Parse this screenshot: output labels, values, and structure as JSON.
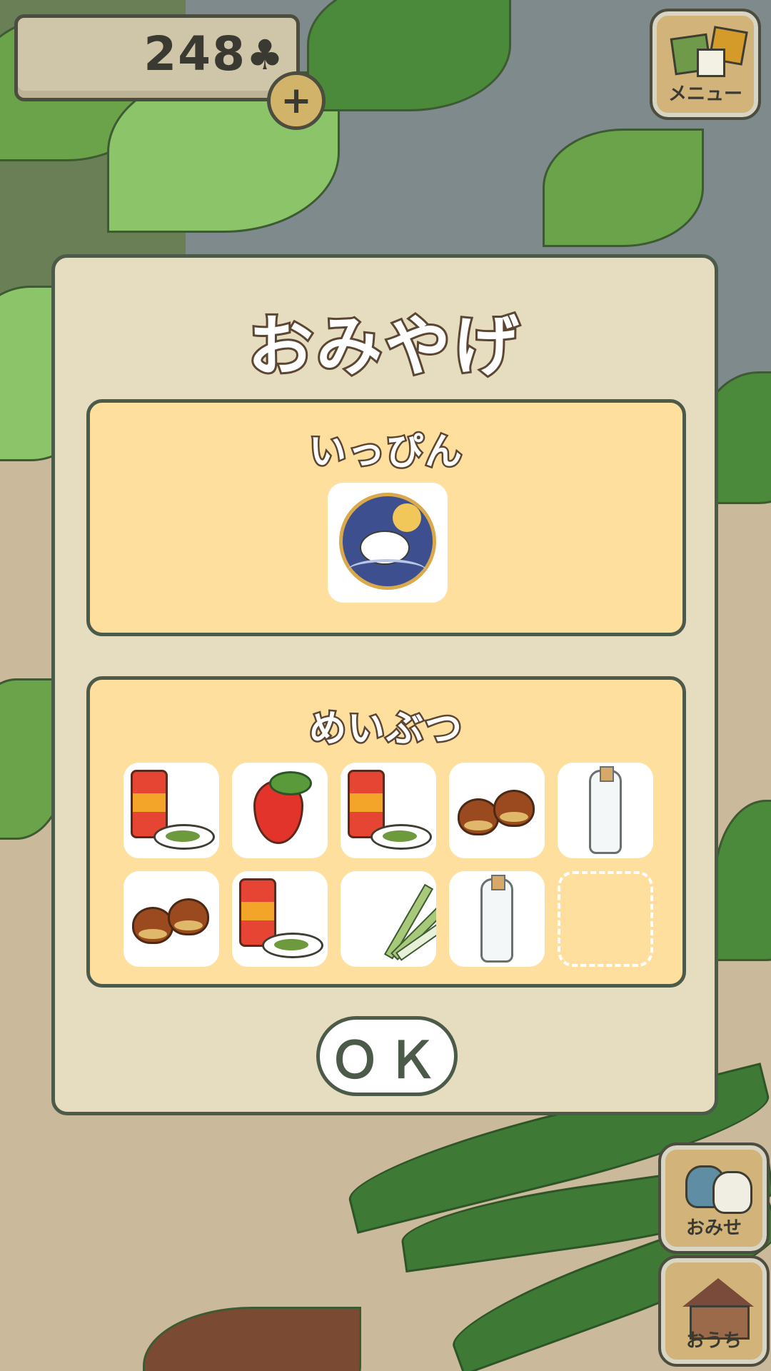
{
  "hud": {
    "clover_count": "248",
    "clover_symbol": "♣",
    "add_label": "+",
    "menu_label": "メニュー",
    "shop_label": "おみせ",
    "home_label": "おうち"
  },
  "dialog": {
    "title": "おみやげ",
    "specialty": {
      "title": "いっぴん",
      "item_icon": "rabbit-moon-plate-icon"
    },
    "meibutsu": {
      "title": "めいぶつ",
      "items": [
        "tea-tin-icon",
        "strawberry-icon",
        "tea-tin-icon",
        "chestnuts-icon",
        "bottle-icon",
        "chestnuts-icon",
        "tea-tin-icon",
        "green-onion-icon",
        "bottle-icon",
        "empty-slot"
      ]
    },
    "ok_label": "ＯＫ"
  },
  "colors": {
    "dialog_bg": "#e6dcbf",
    "panel_bg": "#ffdf9e",
    "border": "#4c5a4a",
    "title_outline": "#5a4632"
  }
}
